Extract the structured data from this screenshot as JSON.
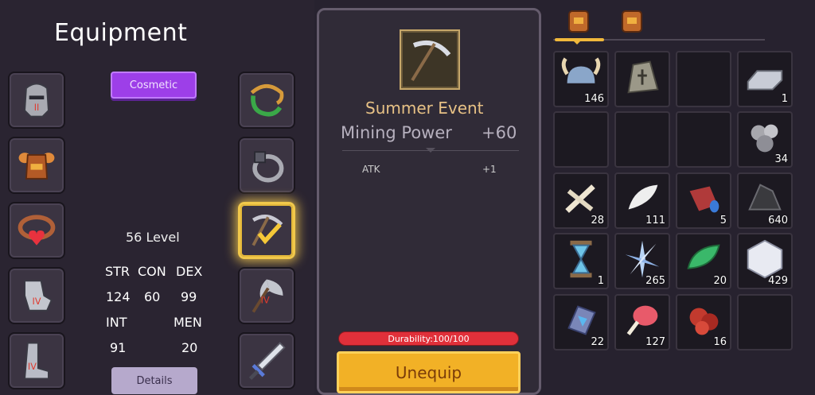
{
  "title": "Equipment",
  "buttons": {
    "cosmetic": "Cosmetic",
    "details": "Details",
    "unequip": "Unequip"
  },
  "character": {
    "level": "56 Level",
    "stats": {
      "str_label": "STR",
      "con_label": "CON",
      "dex_label": "DEX",
      "str": "124",
      "con": "60",
      "dex": "99",
      "int_label": "INT",
      "men_label": "MEN",
      "int": "91",
      "men": "20"
    }
  },
  "equipment_slots": {
    "left": [
      {
        "icon": "knight-helmet-icon",
        "tier": "II"
      },
      {
        "icon": "armor-chest-icon",
        "tier": ""
      },
      {
        "icon": "heart-amulet-icon",
        "tier": ""
      },
      {
        "icon": "gauntlet-icon",
        "tier": "IV"
      },
      {
        "icon": "boots-icon",
        "tier": "IV"
      }
    ],
    "right": [
      {
        "icon": "vine-necklace-icon",
        "tier": ""
      },
      {
        "icon": "ring-icon",
        "tier": ""
      },
      {
        "icon": "pickaxe-icon",
        "tier": "",
        "selected": true
      },
      {
        "icon": "axe-icon",
        "tier": "IV"
      },
      {
        "icon": "sword-icon",
        "tier": ""
      }
    ]
  },
  "selected_item": {
    "icon": "pickaxe-icon",
    "name": "Summer Event",
    "main_stat": "Mining Power",
    "main_value": "+60",
    "sub_stat": "ATK",
    "sub_value": "+1",
    "durability": "Durability:100/100"
  },
  "inventory": {
    "tabs": [
      {
        "icon": "backpack-icon",
        "active": true
      },
      {
        "icon": "backpack-icon",
        "active": false
      }
    ],
    "rows": [
      [
        {
          "icon": "viking-helmet-icon",
          "count": "146"
        },
        {
          "icon": "rune-stone-icon",
          "count": ""
        },
        {
          "icon": "empty",
          "count": ""
        },
        {
          "icon": "iron-ingot-icon",
          "count": "1"
        }
      ],
      [
        {
          "icon": "empty",
          "count": ""
        },
        {
          "icon": "empty",
          "count": ""
        },
        {
          "icon": "empty",
          "count": ""
        },
        {
          "icon": "iron-ore-icon",
          "count": "34"
        }
      ],
      [
        {
          "icon": "bone-icon",
          "count": "28"
        },
        {
          "icon": "feather-icon",
          "count": "111"
        },
        {
          "icon": "red-log-icon",
          "count": "5"
        },
        {
          "icon": "coal-icon",
          "count": "640"
        }
      ],
      [
        {
          "icon": "hourglass-icon",
          "count": "1"
        },
        {
          "icon": "crystal-shards-icon",
          "count": "265"
        },
        {
          "icon": "green-leaf-gem-icon",
          "count": "20"
        },
        {
          "icon": "dice-icon",
          "count": "429"
        }
      ],
      [
        {
          "icon": "blue-gem-icon",
          "count": "22"
        },
        {
          "icon": "meat-icon",
          "count": "127"
        },
        {
          "icon": "ruby-ore-icon",
          "count": "16"
        },
        {
          "icon": "empty",
          "count": ""
        }
      ]
    ]
  },
  "colors": {
    "accent": "#f0b83b",
    "cosmetic": "#9d3fe8",
    "durability": "#e0303a",
    "unequip": "#f2b126",
    "item_name": "#e7c185"
  }
}
